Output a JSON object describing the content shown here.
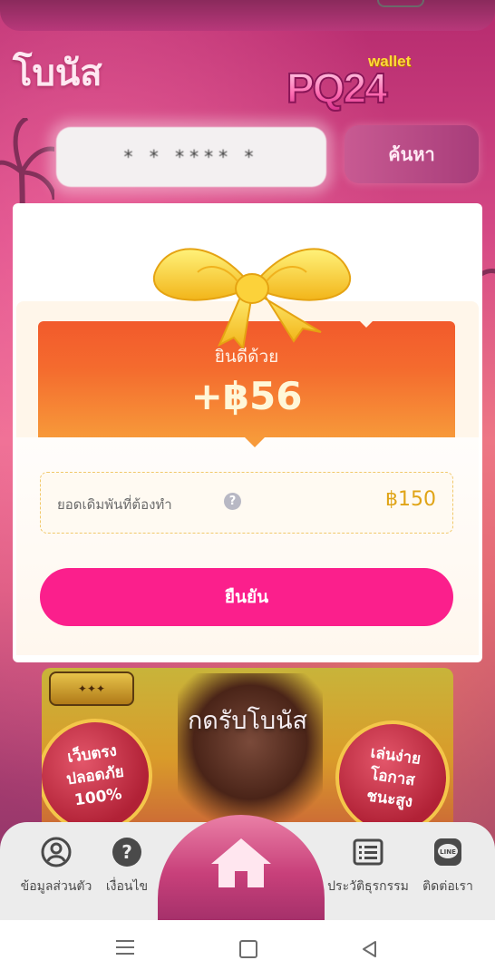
{
  "page": {
    "title": "โบนัส",
    "logo": {
      "top": "wallet",
      "brand": "PQ24"
    }
  },
  "search": {
    "value": "* * **** *",
    "button_label": "ค้นหา"
  },
  "modal": {
    "congrats": "ยินดีด้วย",
    "amount": "+฿56",
    "wager_label": "ยอดเดิมพันที่ต้องทำ",
    "wager_help": "?",
    "wager_value": "฿150",
    "confirm_label": "ยืนยัน"
  },
  "banner": {
    "title": "กดรับโบนัส",
    "badge_left": "เว็บตรง\nปลอดภัย\n100%",
    "badge_right": "เล่นง่าย\nโอกาส\nชนะสูง"
  },
  "bottom_nav": {
    "items": [
      {
        "label": "ข้อมูลส่วนตัว",
        "icon": "user-circle-icon"
      },
      {
        "label": "เงื่อนไข",
        "icon": "question-circle-icon"
      },
      {
        "label": "",
        "icon": "home-icon"
      },
      {
        "label": "ประวัติธุรกรรม",
        "icon": "list-icon"
      },
      {
        "label": "ติดต่อเรา",
        "icon": "line-chat-icon"
      }
    ]
  },
  "colors": {
    "confirm": "#fb1f8c",
    "amount_card": "#f25a2c",
    "wager_value": "#e0a417"
  }
}
